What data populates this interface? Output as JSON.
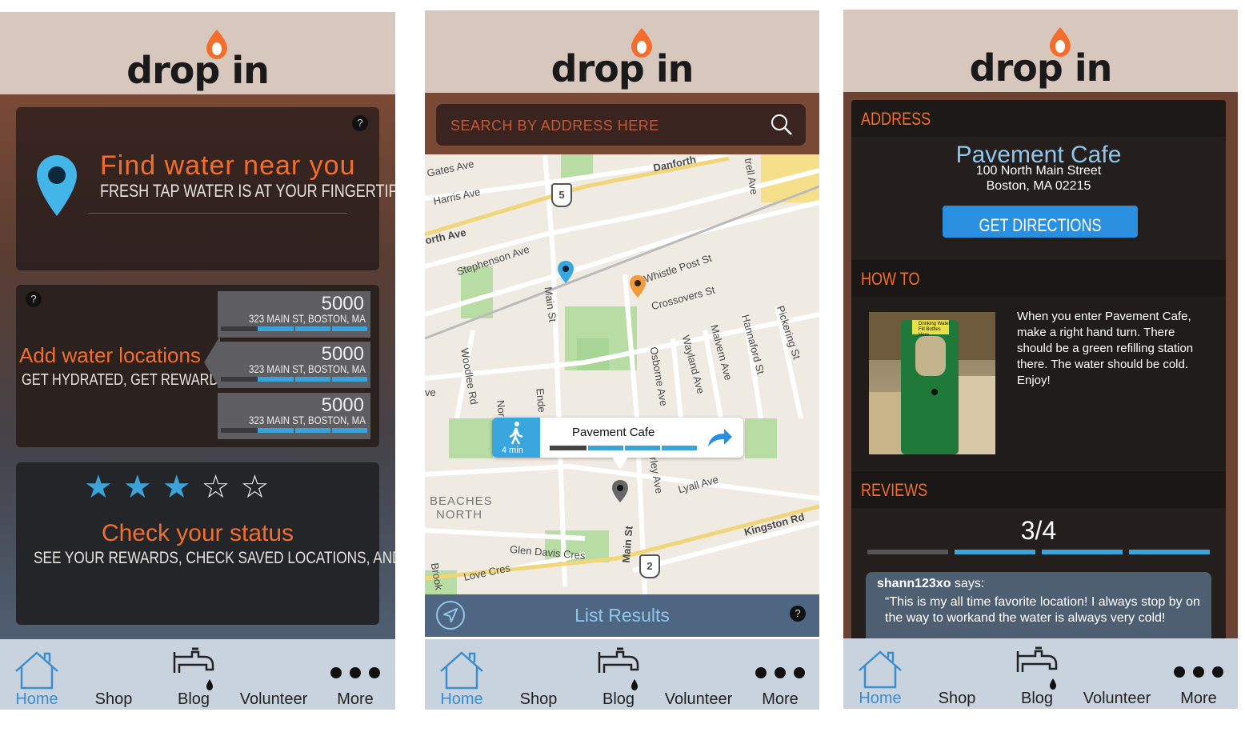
{
  "brand": {
    "logo_text": "drop in",
    "accent": "#f36e2c",
    "blue": "#3ba3d8"
  },
  "tabs": [
    {
      "label": "Home",
      "icon": "house-icon"
    },
    {
      "label": "Shop",
      "icon": ""
    },
    {
      "label": "Blog",
      "icon": "faucet-icon"
    },
    {
      "label": "Volunteer",
      "icon": ""
    },
    {
      "label": "More",
      "icon": "more-dots-icon"
    }
  ],
  "home": {
    "find": {
      "title": "Find water near you",
      "subtitle": "FRESH TAP WATER IS AT YOUR FINGERTIPS",
      "help": "?"
    },
    "add": {
      "title": "Add water locations",
      "subtitle": "GET HYDRATED, GET REWARDED",
      "help": "?",
      "rewards": [
        {
          "points": "5000",
          "address": "323 MAIN ST, BOSTON, MA",
          "progress": 0.75
        },
        {
          "points": "5000",
          "address": "323 MAIN ST, BOSTON, MA",
          "progress": 0.75
        },
        {
          "points": "5000",
          "address": "323 MAIN ST, BOSTON, MA",
          "progress": 0.75
        }
      ]
    },
    "status": {
      "rating": 3,
      "max_rating": 5,
      "title": "Check your status",
      "subtitle": "SEE YOUR REWARDS, CHECK SAVED LOCATIONS, AND MORE"
    }
  },
  "map_screen": {
    "search": {
      "placeholder": "SEARCH BY ADDRESS HERE"
    },
    "map_labels": {
      "gates": "Gates Ave",
      "harris": "Harris Ave",
      "danforth": "Danforth",
      "trell": "trell Ave",
      "north": "orth Ave",
      "stephenson": "Stephenson Ave",
      "whistle": "Whistle Post St",
      "crossovers": "Crossovers St",
      "main1": "Main St",
      "woodlee": "Woodlee Rd",
      "ende": "Ende",
      "nor": "Nor",
      "osborne": "Osborne Ave",
      "wayland": "Wayland Ave",
      "malvern": "Malvern Ave",
      "hannaford": "Hannaford St",
      "pickering": "Pickering St",
      "beaches1": "BEACHES",
      "beaches2": "NORTH",
      "lyall": "Lyall Ave",
      "erley": "erley Ave",
      "kingston": "Kingston Rd",
      "glen": "Glen Davis Cres",
      "love": "Love Cres",
      "main2": "Main St",
      "brook": "Brook",
      "ve": "ve",
      "route5": "5",
      "route2": "2"
    },
    "callout": {
      "name": "Pavement Cafe",
      "eta": "4 min",
      "progress": 0.25
    },
    "list_results": "List Results",
    "help": "?"
  },
  "detail": {
    "address_header": "ADDRESS",
    "name": "Pavement Cafe",
    "street": "100 North Main Street",
    "city": "Boston, MA 02215",
    "directions": "GET DIRECTIONS",
    "howto_header": "HOW TO",
    "howto_text": "When you enter Pavement Cafe, make a right hand turn. There should be a green refilling station there. The water should be cold. Enjoy!",
    "photo_sign": "Drinking Water Fill Bottles Here",
    "reviews_header": "REVIEWS",
    "rating_text": "3/4",
    "rating_value": 3,
    "rating_max": 4,
    "review": {
      "user": "shann123xo",
      "says": " says:",
      "text": "“This is my all time favorite location! I always stop by on the way to workand the water is always very cold!"
    }
  }
}
